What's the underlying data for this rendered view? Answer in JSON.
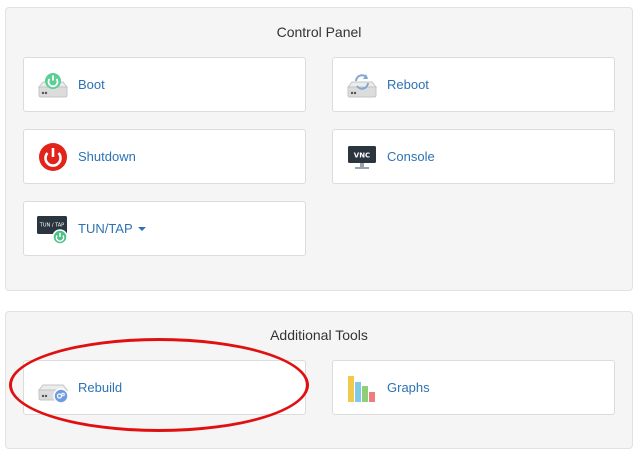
{
  "control_panel": {
    "title": "Control Panel",
    "tiles": [
      {
        "label": "Boot",
        "icon": "boot-server-icon"
      },
      {
        "label": "Reboot",
        "icon": "reboot-server-icon"
      },
      {
        "label": "Shutdown",
        "icon": "power-icon"
      },
      {
        "label": "Console",
        "icon": "vnc-console-icon"
      },
      {
        "label": "TUN/TAP",
        "icon": "tun-tap-icon",
        "has_dropdown": true
      }
    ]
  },
  "additional_tools": {
    "title": "Additional Tools",
    "tiles": [
      {
        "label": "Rebuild",
        "icon": "rebuild-server-icon"
      },
      {
        "label": "Graphs",
        "icon": "bar-chart-icon"
      }
    ]
  },
  "annotation": {
    "shape": "ellipse",
    "color": "#e01010",
    "target": "Rebuild"
  },
  "colors": {
    "link": "#2d73b4",
    "panel_background": "#f5f5f5",
    "power_red": "#e2231a",
    "boot_green": "#4cc28a"
  },
  "icon_text": {
    "vnc": "VNC",
    "tun_tap": "TUN / TAP"
  }
}
